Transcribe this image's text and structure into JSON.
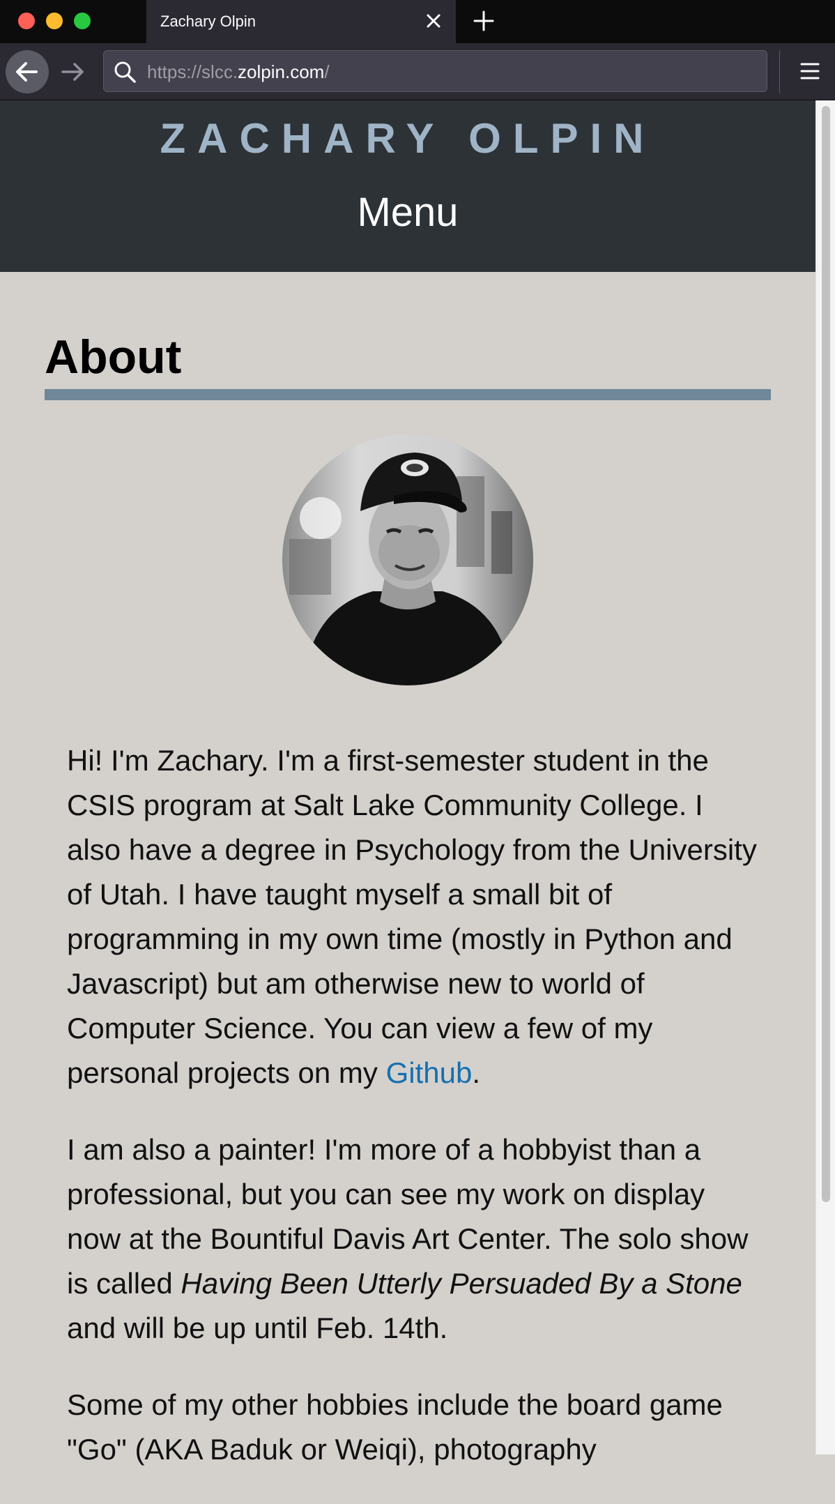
{
  "browser": {
    "tab_title": "Zachary Olpin",
    "url_prefix": "https://slcc.",
    "url_domain": "zolpin.com",
    "url_suffix": "/"
  },
  "site": {
    "title": "ZACHARY OLPIN",
    "menu_label": "Menu"
  },
  "about": {
    "heading": "About",
    "photo": "profile-photo",
    "p1_text": "Hi! I'm Zachary. I'm a first-semester student in the CSIS program at Salt Lake Community College. I also have a degree in Psychology from the University of Utah. I have taught myself a small bit of programming in my own time (mostly in Python and Javascript) but am otherwise new to world of Computer Science. You can view a few of my personal projects on my ",
    "p1_link": "Github",
    "p1_end": ".",
    "p2_text": "I am also a painter! I'm more of a hobbyist than a professional, but you can see my work on display now at the Bountiful Davis Art Center. The solo show is called ",
    "p2_title": "Having Been Utterly Persuaded By a Stone",
    "p2_end": " and will be up until Feb. 14th.",
    "p3_text": "Some of my other hobbies include the board game \"Go\" (AKA Baduk or Weiqi), photography"
  },
  "colors": {
    "header_bg": "#2d3237",
    "title_color": "#9fb4c6",
    "page_bg": "#d4d1cd",
    "rule_color": "#6f8799",
    "link_color": "#1470b0"
  }
}
